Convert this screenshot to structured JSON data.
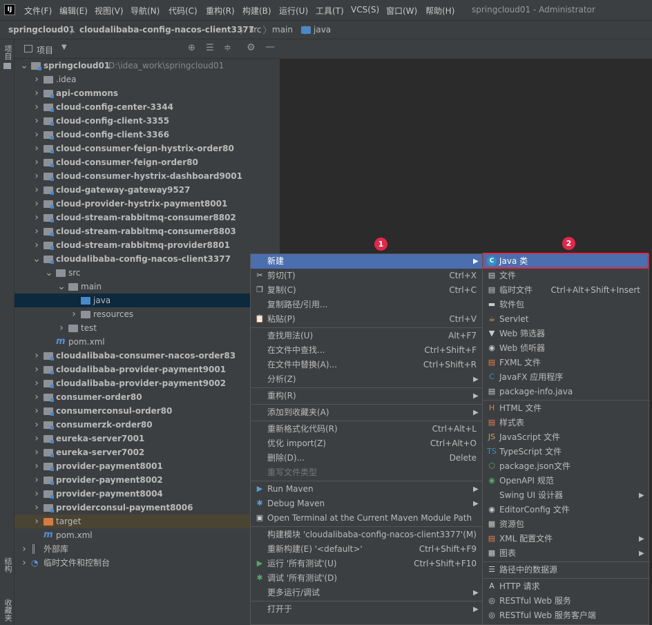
{
  "menubar": {
    "logo": "IJ",
    "items": [
      "文件(F)",
      "编辑(E)",
      "视图(V)",
      "导航(N)",
      "代码(C)",
      "重构(R)",
      "构建(B)",
      "运行(U)",
      "工具(T)",
      "VCS(S)",
      "窗口(W)",
      "帮助(H)"
    ],
    "title": "springcloud01 - Administrator"
  },
  "breadcrumb": [
    "springcloud01",
    "cloudalibaba-config-nacos-client3377",
    "src",
    "main",
    "java"
  ],
  "side_tabs": {
    "project": "项目",
    "structure": "结构",
    "favorites": "收藏夹"
  },
  "project_panel": {
    "title": "项目"
  },
  "tree": [
    {
      "label": "springcloud01",
      "path": "D:\\idea_work\\springcloud01",
      "depth": 0,
      "arrow": "down",
      "icon": "folder-module",
      "bold": true
    },
    {
      "label": ".idea",
      "depth": 1,
      "arrow": "right",
      "icon": "folder"
    },
    {
      "label": "api-commons",
      "depth": 1,
      "arrow": "right",
      "icon": "folder-module",
      "bold": true
    },
    {
      "label": "cloud-config-center-3344",
      "depth": 1,
      "arrow": "right",
      "icon": "folder-module",
      "bold": true
    },
    {
      "label": "cloud-config-client-3355",
      "depth": 1,
      "arrow": "right",
      "icon": "folder-module",
      "bold": true
    },
    {
      "label": "cloud-config-client-3366",
      "depth": 1,
      "arrow": "right",
      "icon": "folder-module",
      "bold": true
    },
    {
      "label": "cloud-consumer-feign-hystrix-order80",
      "depth": 1,
      "arrow": "right",
      "icon": "folder-module",
      "bold": true
    },
    {
      "label": "cloud-consumer-feign-order80",
      "depth": 1,
      "arrow": "right",
      "icon": "folder-module",
      "bold": true
    },
    {
      "label": "cloud-consumer-hystrix-dashboard9001",
      "depth": 1,
      "arrow": "right",
      "icon": "folder-module",
      "bold": true
    },
    {
      "label": "cloud-gateway-gateway9527",
      "depth": 1,
      "arrow": "right",
      "icon": "folder-module",
      "bold": true
    },
    {
      "label": "cloud-provider-hystrix-payment8001",
      "depth": 1,
      "arrow": "right",
      "icon": "folder-module",
      "bold": true
    },
    {
      "label": "cloud-stream-rabbitmq-consumer8802",
      "depth": 1,
      "arrow": "right",
      "icon": "folder-module",
      "bold": true
    },
    {
      "label": "cloud-stream-rabbitmq-consumer8803",
      "depth": 1,
      "arrow": "right",
      "icon": "folder-module",
      "bold": true
    },
    {
      "label": "cloud-stream-rabbitmq-provider8801",
      "depth": 1,
      "arrow": "right",
      "icon": "folder-module",
      "bold": true
    },
    {
      "label": "cloudalibaba-config-nacos-client3377",
      "depth": 1,
      "arrow": "down",
      "icon": "folder-module",
      "bold": true
    },
    {
      "label": "src",
      "depth": 2,
      "arrow": "down",
      "icon": "folder"
    },
    {
      "label": "main",
      "depth": 3,
      "arrow": "down",
      "icon": "folder"
    },
    {
      "label": "java",
      "depth": 4,
      "arrow": "",
      "icon": "folder-source",
      "selected": true
    },
    {
      "label": "resources",
      "depth": 4,
      "arrow": "right",
      "icon": "folder-resources"
    },
    {
      "label": "test",
      "depth": 3,
      "arrow": "right",
      "icon": "folder"
    },
    {
      "label": "pom.xml",
      "depth": 2,
      "arrow": "",
      "icon": "maven"
    },
    {
      "label": "cloudalibaba-consumer-nacos-order83",
      "depth": 1,
      "arrow": "right",
      "icon": "folder-module",
      "bold": true
    },
    {
      "label": "cloudalibaba-provider-payment9001",
      "depth": 1,
      "arrow": "right",
      "icon": "folder-module",
      "bold": true
    },
    {
      "label": "cloudalibaba-provider-payment9002",
      "depth": 1,
      "arrow": "right",
      "icon": "folder-module",
      "bold": true
    },
    {
      "label": "consumer-order80",
      "depth": 1,
      "arrow": "right",
      "icon": "folder-module",
      "bold": true
    },
    {
      "label": "consumerconsul-order80",
      "depth": 1,
      "arrow": "right",
      "icon": "folder-module",
      "bold": true
    },
    {
      "label": "consumerzk-order80",
      "depth": 1,
      "arrow": "right",
      "icon": "folder-module",
      "bold": true
    },
    {
      "label": "eureka-server7001",
      "depth": 1,
      "arrow": "right",
      "icon": "folder-module",
      "bold": true
    },
    {
      "label": "eureka-server7002",
      "depth": 1,
      "arrow": "right",
      "icon": "folder-module",
      "bold": true
    },
    {
      "label": "provider-payment8001",
      "depth": 1,
      "arrow": "right",
      "icon": "folder-module",
      "bold": true
    },
    {
      "label": "provider-payment8002",
      "depth": 1,
      "arrow": "right",
      "icon": "folder-module",
      "bold": true
    },
    {
      "label": "provider-payment8004",
      "depth": 1,
      "arrow": "right",
      "icon": "folder-module",
      "bold": true
    },
    {
      "label": "providerconsul-payment8006",
      "depth": 1,
      "arrow": "right",
      "icon": "folder-module",
      "bold": true
    },
    {
      "label": "target",
      "depth": 1,
      "arrow": "right",
      "icon": "folder-excluded",
      "target": true
    },
    {
      "label": "pom.xml",
      "depth": 1,
      "arrow": "",
      "icon": "maven"
    },
    {
      "label": "外部库",
      "depth": 0,
      "arrow": "right",
      "icon": "library"
    },
    {
      "label": "临时文件和控制台",
      "depth": 0,
      "arrow": "right",
      "icon": "scratch"
    }
  ],
  "context_menu": [
    {
      "label": "新建",
      "submenu": true,
      "highlight": true
    },
    {
      "label": "剪切(T)",
      "shortcut": "Ctrl+X",
      "icon": "cut-icon"
    },
    {
      "label": "复制(C)",
      "shortcut": "Ctrl+C",
      "icon": "copy-icon"
    },
    {
      "label": "复制路径/引用..."
    },
    {
      "label": "粘贴(P)",
      "shortcut": "Ctrl+V",
      "icon": "paste-icon"
    },
    {
      "sep": true
    },
    {
      "label": "查找用法(U)",
      "shortcut": "Alt+F7"
    },
    {
      "label": "在文件中查找...",
      "shortcut": "Ctrl+Shift+F"
    },
    {
      "label": "在文件中替换(A)...",
      "shortcut": "Ctrl+Shift+R"
    },
    {
      "label": "分析(Z)",
      "submenu": true
    },
    {
      "sep": true
    },
    {
      "label": "重构(R)",
      "submenu": true
    },
    {
      "sep": true
    },
    {
      "label": "添加到收藏夹(A)",
      "submenu": true
    },
    {
      "sep": true
    },
    {
      "label": "重新格式化代码(R)",
      "shortcut": "Ctrl+Alt+L"
    },
    {
      "label": "优化 import(Z)",
      "shortcut": "Ctrl+Alt+O"
    },
    {
      "label": "删除(D)...",
      "shortcut": "Delete"
    },
    {
      "label": "重写文件类型",
      "disabled": true
    },
    {
      "sep": true
    },
    {
      "label": "Run Maven",
      "submenu": true,
      "icon": "run-maven-icon"
    },
    {
      "label": "Debug Maven",
      "submenu": true,
      "icon": "debug-maven-icon"
    },
    {
      "label": "Open Terminal at the Current Maven Module Path",
      "icon": "terminal-icon"
    },
    {
      "sep": true
    },
    {
      "label": "构建模块 'cloudalibaba-config-nacos-client3377'(M)"
    },
    {
      "label": "重新构建(E) '<default>'",
      "shortcut": "Ctrl+Shift+F9"
    },
    {
      "label": "运行 '所有测试'(U)",
      "shortcut": "Ctrl+Shift+F10",
      "icon": "run-icon"
    },
    {
      "label": "调试 '所有测试'(D)",
      "icon": "debug-icon"
    },
    {
      "label": "更多运行/调试",
      "submenu": true
    },
    {
      "sep": true
    },
    {
      "label": "打开于",
      "submenu": true
    }
  ],
  "new_submenu": [
    {
      "label": "Java 类",
      "icon": "java-class-icon",
      "highlight": true
    },
    {
      "label": "文件",
      "icon": "file-icon"
    },
    {
      "label": "临时文件",
      "shortcut": "Ctrl+Alt+Shift+Insert",
      "icon": "scratch-file-icon"
    },
    {
      "label": "软件包",
      "icon": "package-icon"
    },
    {
      "label": "Servlet",
      "icon": "servlet-icon"
    },
    {
      "label": "Web 筛选器",
      "icon": "filter-icon"
    },
    {
      "label": "Web 侦听器",
      "icon": "listener-icon"
    },
    {
      "label": "FXML 文件",
      "icon": "fxml-icon"
    },
    {
      "label": "JavaFX 应用程序",
      "icon": "javafx-icon"
    },
    {
      "label": "package-info.java",
      "icon": "package-info-icon"
    },
    {
      "sep": true
    },
    {
      "label": "HTML 文件",
      "icon": "html-icon"
    },
    {
      "label": "样式表",
      "icon": "css-icon"
    },
    {
      "label": "JavaScript 文件",
      "icon": "js-icon"
    },
    {
      "label": "TypeScript 文件",
      "icon": "ts-icon"
    },
    {
      "label": "package.json文件",
      "icon": "npm-icon"
    },
    {
      "label": "OpenAPI 规范",
      "icon": "openapi-icon"
    },
    {
      "label": "Swing UI 设计器",
      "submenu": true
    },
    {
      "label": "EditorConfig 文件",
      "icon": "editorconfig-icon"
    },
    {
      "label": "资源包",
      "icon": "resource-bundle-icon"
    },
    {
      "label": "XML 配置文件",
      "submenu": true,
      "icon": "xml-icon"
    },
    {
      "label": "图表",
      "submenu": true,
      "icon": "diagram-icon"
    },
    {
      "sep": true
    },
    {
      "label": "路径中的数据源",
      "icon": "datasource-icon"
    },
    {
      "sep": true
    },
    {
      "label": "HTTP 请求",
      "icon": "http-icon"
    },
    {
      "label": "RESTful Web 服务",
      "icon": "rest-icon"
    },
    {
      "label": "RESTful Web 服务客户端",
      "icon": "rest-client-icon"
    }
  ],
  "annotations": {
    "badge1": "1",
    "badge2": "2"
  },
  "colors": {
    "highlight": "#4b6eaf",
    "annotation": "#e0294a",
    "selection": "#0d293e"
  }
}
